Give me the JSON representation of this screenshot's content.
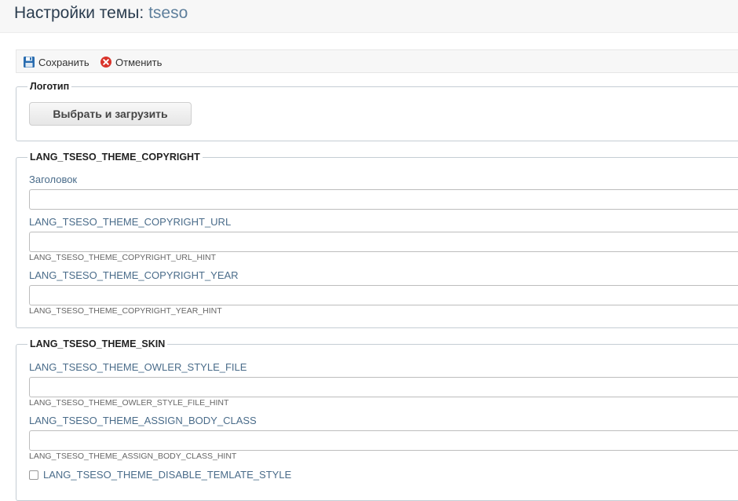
{
  "header": {
    "title_prefix": "Настройки темы:",
    "theme_name": "tseso"
  },
  "toolbar": {
    "save_label": "Сохранить",
    "cancel_label": "Отменить"
  },
  "logo_section": {
    "legend": "Логотип",
    "upload_label": "Выбрать и загрузить"
  },
  "copyright_section": {
    "legend": "LANG_TSESO_THEME_COPYRIGHT",
    "fields": [
      {
        "label": "Заголовок",
        "value": "",
        "hint": ""
      },
      {
        "label": "LANG_TSESO_THEME_COPYRIGHT_URL",
        "value": "",
        "hint": "LANG_TSESO_THEME_COPYRIGHT_URL_HINT"
      },
      {
        "label": "LANG_TSESO_THEME_COPYRIGHT_YEAR",
        "value": "",
        "hint": "LANG_TSESO_THEME_COPYRIGHT_YEAR_HINT"
      }
    ]
  },
  "skin_section": {
    "legend": "LANG_TSESO_THEME_SKIN",
    "fields": [
      {
        "label": "LANG_TSESO_THEME_OWLER_STYLE_FILE",
        "value": "",
        "hint": "LANG_TSESO_THEME_OWLER_STYLE_FILE_HINT"
      },
      {
        "label": "LANG_TSESO_THEME_ASSIGN_BODY_CLASS",
        "value": "",
        "hint": "LANG_TSESO_THEME_ASSIGN_BODY_CLASS_HINT"
      }
    ],
    "checkbox_label": "LANG_TSESO_THEME_DISABLE_TEMLATE_STYLE",
    "checkbox_checked": false
  },
  "colors": {
    "title": "#2b3d4f",
    "theme_name": "#5e7f9c",
    "field_label": "#4a6c8a",
    "cancel_icon": "#d9342b",
    "save_icon": "#2a6db0"
  },
  "icons": {
    "save": "floppy-disk-icon",
    "cancel": "cancel-circle-icon"
  }
}
